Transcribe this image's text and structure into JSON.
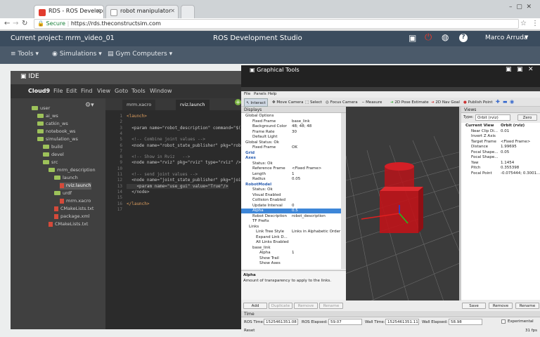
{
  "browser": {
    "tabs": [
      {
        "title": "RDS - ROS Developm"
      },
      {
        "title": "robot manipulator"
      }
    ],
    "secure_label": "Secure",
    "url": "https://rds.theconstructsim.com"
  },
  "rds": {
    "project": "Current project: mrm_video_01",
    "app_title": "ROS Development Studio",
    "user": "Marco Arruda",
    "menu": [
      "Tools",
      "Simulations",
      "Gym Computers"
    ]
  },
  "ide": {
    "title": "IDE",
    "menu": [
      "Cloud9",
      "File",
      "Edit",
      "Find",
      "View",
      "Goto",
      "Tools",
      "Window"
    ],
    "tree": [
      {
        "label": "user",
        "kind": "folder"
      },
      {
        "label": "ai_ws",
        "kind": "folder"
      },
      {
        "label": "catkin_ws",
        "kind": "folder"
      },
      {
        "label": "notebook_ws",
        "kind": "folder"
      },
      {
        "label": "simulation_ws",
        "kind": "folder"
      },
      {
        "label": "build",
        "kind": "folder"
      },
      {
        "label": "devel",
        "kind": "folder"
      },
      {
        "label": "src",
        "kind": "folder"
      },
      {
        "label": "mrm_description",
        "kind": "folder"
      },
      {
        "label": "launch",
        "kind": "folder"
      },
      {
        "label": "rviz.launch",
        "kind": "file"
      },
      {
        "label": "urdf",
        "kind": "folder"
      },
      {
        "label": "mrm.xacro",
        "kind": "file"
      },
      {
        "label": "CMakeLists.txt",
        "kind": "file"
      },
      {
        "label": "package.xml",
        "kind": "file"
      },
      {
        "label": "CMakeLists.txt",
        "kind": "file"
      }
    ],
    "editor_tabs": [
      "mrm.xacro",
      "rviz.launch"
    ],
    "line_numbers": [
      "1",
      "2",
      "3",
      "4",
      "5",
      "6",
      "7",
      "8",
      "9",
      "10",
      "11",
      "12",
      "13",
      "14",
      "15",
      "16",
      "17"
    ],
    "code": [
      "<launch>",
      "",
      "  <param name=\"robot_description\" command=\"$(f",
      "",
      "  <!-- Combine joint values -->",
      "  <node name=\"robot_state_publisher\" pkg=\"robo",
      "",
      "  <!-- Show in Rviz   -->",
      "  <node name=\"rviz\" pkg=\"rviz\" type=\"rviz\" />",
      "",
      "  <!-- send joint values -->",
      "  <node name=\"joint_state_publisher\" pkg=\"join",
      "    <param name=\"use_gui\" value=\"True\"/>",
      "  </node>",
      "",
      "</launch>",
      ""
    ]
  },
  "graphical_tools": {
    "title": "Graphical Tools",
    "rviz_menu": [
      "File",
      "Panels",
      "Help"
    ],
    "toolbar": [
      "Interact",
      "Move Camera",
      "Select",
      "Focus Camera",
      "Measure",
      "2D Pose Estimate",
      "2D Nav Goal",
      "Publish Point"
    ],
    "displays": {
      "header": "Displays",
      "rows": [
        {
          "k": "Global Options",
          "v": ""
        },
        {
          "k": "Fixed Frame",
          "v": "base_link"
        },
        {
          "k": "Background Color",
          "v": "48; 48; 48"
        },
        {
          "k": "Frame Rate",
          "v": "30"
        },
        {
          "k": "Default Light",
          "v": ""
        },
        {
          "k": "Global Status: Ok",
          "v": ""
        },
        {
          "k": "Fixed Frame",
          "v": "OK"
        },
        {
          "k": "Grid",
          "v": ""
        },
        {
          "k": "Axes",
          "v": ""
        },
        {
          "k": "Status: Ok",
          "v": ""
        },
        {
          "k": "Reference Frame",
          "v": "<Fixed Frame>"
        },
        {
          "k": "Length",
          "v": "1"
        },
        {
          "k": "Radius",
          "v": "0.05"
        },
        {
          "k": "RobotModel",
          "v": ""
        },
        {
          "k": "Status: Ok",
          "v": ""
        },
        {
          "k": "Visual Enabled",
          "v": ""
        },
        {
          "k": "Collision Enabled",
          "v": ""
        },
        {
          "k": "Update Interval",
          "v": "0"
        },
        {
          "k": "Alpha",
          "v": "0.5"
        },
        {
          "k": "Robot Description",
          "v": "robot_description"
        },
        {
          "k": "TF Prefix",
          "v": ""
        },
        {
          "k": "Links",
          "v": ""
        },
        {
          "k": "Link Tree Style",
          "v": "Links in Alphabetic Order"
        },
        {
          "k": "Expand Link D...",
          "v": ""
        },
        {
          "k": "All Links Enabled",
          "v": ""
        },
        {
          "k": "base_link",
          "v": ""
        },
        {
          "k": "Alpha",
          "v": "1"
        },
        {
          "k": "Show Trail",
          "v": ""
        },
        {
          "k": "Show Axes",
          "v": ""
        }
      ],
      "desc_title": "Alpha",
      "desc_text": "Amount of transparency to apply to the links.",
      "buttons": [
        "Add",
        "Duplicate",
        "Remove",
        "Rename"
      ]
    },
    "views": {
      "header": "Views",
      "type_label": "Type:",
      "type_value": "Orbit (rviz)",
      "zero": "Zero",
      "rows": [
        {
          "k": "Current View",
          "v": "Orbit (rviz)"
        },
        {
          "k": "Near Clip Di...",
          "v": "0.01"
        },
        {
          "k": "Invert Z Axis",
          "v": ""
        },
        {
          "k": "Target Frame",
          "v": "<Fixed Frame>"
        },
        {
          "k": "Distance",
          "v": "1.99695"
        },
        {
          "k": "Focal Shape...",
          "v": "0.05"
        },
        {
          "k": "Focal Shape...",
          "v": ""
        },
        {
          "k": "Yaw",
          "v": "1.1454"
        },
        {
          "k": "Pitch",
          "v": "0.355398"
        },
        {
          "k": "Focal Point",
          "v": "-0.075444; 0.3001..."
        }
      ],
      "buttons": [
        "Save",
        "Remove",
        "Rename"
      ]
    },
    "time": {
      "header": "Time",
      "ros_time_label": "ROS Time:",
      "ros_time": "1525461351.08",
      "ros_elapsed_label": "ROS Elapsed:",
      "ros_elapsed": "59.07",
      "wall_time_label": "Wall Time:",
      "wall_time": "1525461351.11",
      "wall_elapsed_label": "Wall Elapsed:",
      "wall_elapsed": "58.98",
      "experimental": "Experimental",
      "reset": "Reset",
      "fps": "31 fps"
    }
  }
}
